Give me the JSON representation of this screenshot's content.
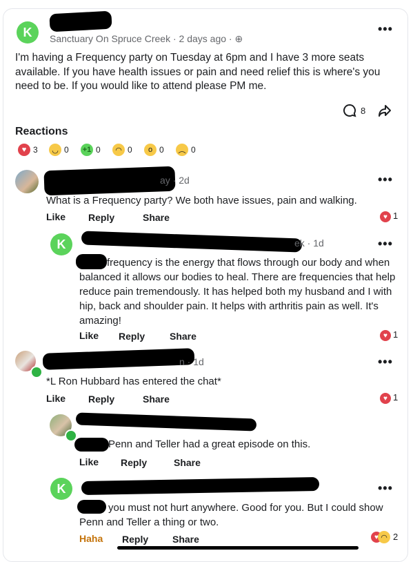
{
  "post": {
    "avatar_letter": "K",
    "group": "Sanctuary On Spruce Creek · 2 days ago · ",
    "globe": "⊕",
    "text": "I'm having a Frequency party on Tuesday at 6pm and I have 3 more seats available. If you have health issues or pain and need relief this is where's you need to be. If you would like to attend please PM me.",
    "comment_count": "8",
    "more": "•••"
  },
  "reactions": {
    "title": "Reactions",
    "items": [
      {
        "icon": "heart-icon",
        "count": "3"
      },
      {
        "icon": "smile-icon",
        "count": "0"
      },
      {
        "icon": "plus-one-icon",
        "count": "0"
      },
      {
        "icon": "laugh-icon",
        "count": "0"
      },
      {
        "icon": "wow-icon",
        "count": "0"
      },
      {
        "icon": "sad-icon",
        "count": "0"
      }
    ]
  },
  "comments": [
    {
      "meta": "ay · 2d",
      "text": "What is a Frequency party?  We both have issues, pain and walking.",
      "like": "Like",
      "reply": "Reply",
      "share": "Share",
      "reactions": "1"
    },
    {
      "avatar_letter": "K",
      "meta": "ek · 1d",
      "text": "frequency is the energy that flows through our body and when balanced it allows our bodies to heal. There are frequencies that help reduce pain tremendously. It has helped both my husband and I with hip, back and shoulder pain. It helps with arthritis pain as well. It's amazing!",
      "like": "Like",
      "reply": "Reply",
      "share": "Share",
      "reactions": "1"
    },
    {
      "meta": "n · 1d",
      "text": "*L Ron Hubbard has entered the chat*",
      "like": "Like",
      "reply": "Reply",
      "share": "Share",
      "reactions": "1"
    },
    {
      "text": "Penn and Teller had a great episode on this.",
      "like": "Like",
      "reply": "Reply",
      "share": "Share"
    },
    {
      "avatar_letter": "K",
      "text": "you must not hurt anywhere. Good for you. But I could show Penn and Teller a thing or two.",
      "like": "Haha",
      "reply": "Reply",
      "share": "Share",
      "reactions": "2"
    }
  ],
  "colors": {
    "accent_green": "#5bd35b",
    "heart_red": "#e1424c",
    "haha_orange": "#c4730a"
  }
}
